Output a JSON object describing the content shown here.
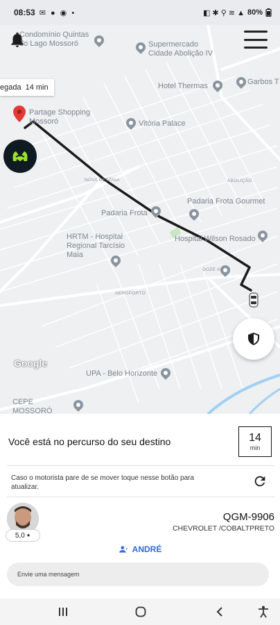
{
  "status_bar": {
    "time": "08:53",
    "battery": "80%"
  },
  "map": {
    "labels": {
      "condominio": "Condomínio Quintas do Lago Mossoró",
      "supermercado": "Supermercado Cidade Abolição IV",
      "hotel_thermas": "Hotel Thermas",
      "garbos": "Garbos T",
      "partage": "Partage Shopping Mossoró",
      "vitoria": "Vitória Palace",
      "nova_betania": "NOVA BETÂNIA",
      "abolicao": "ABOLIÇÃO",
      "padaria_frota": "Padaria Frota",
      "padaria_gourmet": "Padaria Frota Gourmet",
      "hrtm": "HRTM - Hospital Regional Tarcísio Maia",
      "hospital_wilson": "Hospital Wilson Rosado",
      "doze_anos": "DOZE ANOS",
      "aeroporto": "AEROPORTO",
      "upa": "UPA - Belo Horizonte",
      "cepe": "CEPE MOSSORÓ (ASPETRO)",
      "google": "Google"
    },
    "arrival_chip": {
      "label": "egada",
      "time": "14 min"
    }
  },
  "panel": {
    "status_message": "Você está no percurso do seu destino",
    "eta": {
      "value": "14",
      "unit": "min"
    },
    "refresh_hint": "Caso o motorista pare de se mover toque nesse botão para atualizar.",
    "driver": {
      "rating": "5,0",
      "name": "ANDRÉ",
      "plate": "QGM-9906",
      "car": "CHEVROLET /COBALTPRETO"
    },
    "message_placeholder": "Envie uma mensagem"
  },
  "colors": {
    "route": "#1a1a1a",
    "pin": "#e53935",
    "accent": "#2e6bd8",
    "logo_green": "#9be22d"
  }
}
